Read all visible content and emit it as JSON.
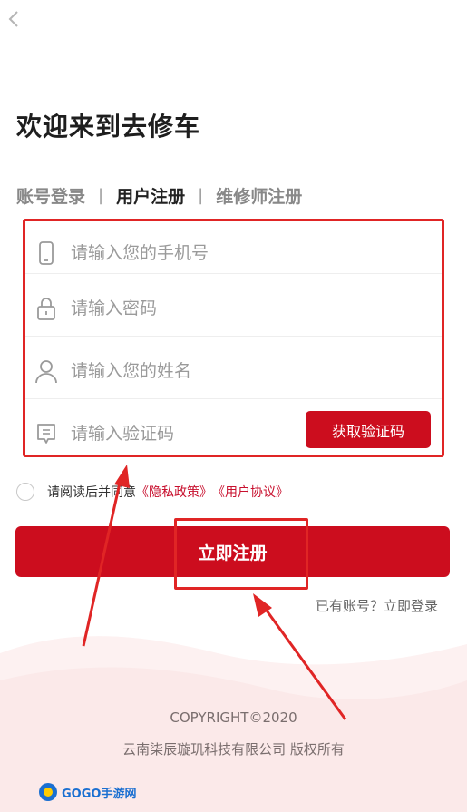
{
  "header": {
    "back_icon": "chevron-left-icon"
  },
  "welcome": {
    "title": "欢迎来到去修车"
  },
  "tabs": [
    {
      "label": "账号登录",
      "active": false
    },
    {
      "label": "用户注册",
      "active": true
    },
    {
      "label": "维修师注册",
      "active": false
    }
  ],
  "tab_separator": "|",
  "form": {
    "phone": {
      "icon": "phone-icon",
      "placeholder": "请输入您的手机号",
      "value": ""
    },
    "password": {
      "icon": "lock-icon",
      "placeholder": "请输入密码",
      "value": ""
    },
    "name": {
      "icon": "user-icon",
      "placeholder": "请输入您的姓名",
      "value": ""
    },
    "code": {
      "icon": "message-icon",
      "placeholder": "请输入验证码",
      "value": ""
    },
    "get_code_label": "获取验证码"
  },
  "agreement": {
    "prefix": "请阅读后并同意",
    "privacy": "《隐私政策》",
    "terms": "《用户协议》"
  },
  "submit_label": "立即注册",
  "login_link": "已有账号？立即登录",
  "footer": {
    "copyright": "COPYRIGHT©2020",
    "company": "云南柒辰璇玑科技有限公司 版权所有"
  },
  "watermark": {
    "text": "GOGO手游网"
  },
  "colors": {
    "accent": "#cc0d1e",
    "annotation": "#e02525"
  }
}
